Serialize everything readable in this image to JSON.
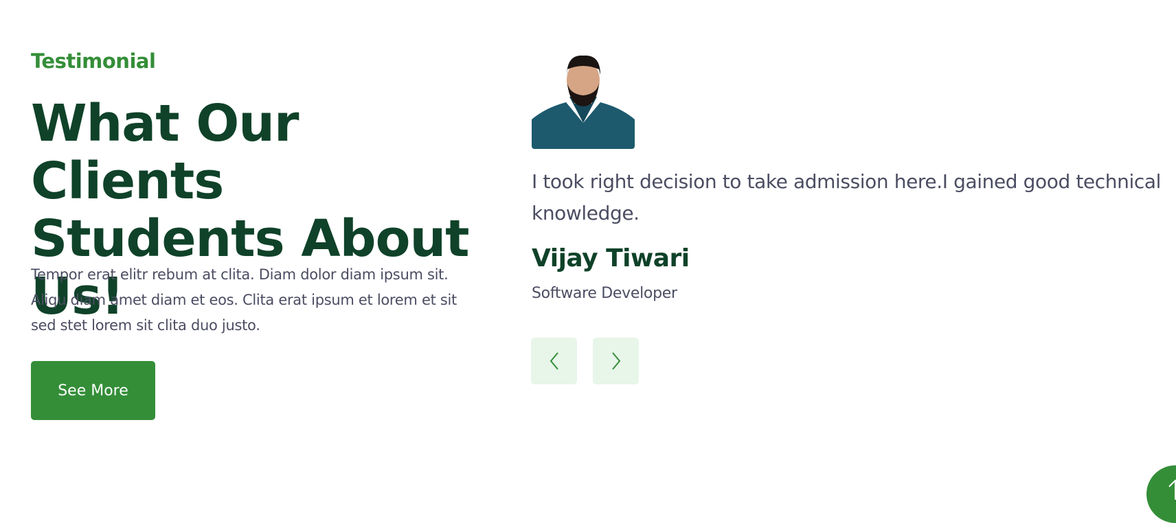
{
  "section": {
    "eyebrow": "Testimonial",
    "title_line1": "What Our Clients",
    "title_line2": "Students About Us!",
    "description": "Tempor erat elitr rebum at clita. Diam dolor diam ipsum sit. Aliqu diam amet diam et eos. Clita erat ipsum et lorem et sit sed stet lorem sit clita duo justo.",
    "button_label": "See More"
  },
  "testimonial": {
    "quote": "I took right decision to take admission here.I gained good technical knowledge.",
    "name": "Vijay Tiwari",
    "role": "Software Developer"
  },
  "colors": {
    "accent": "#348e38",
    "heading": "#0f4229",
    "body": "#4b4d62",
    "nav_bg": "#e8f5e9"
  }
}
